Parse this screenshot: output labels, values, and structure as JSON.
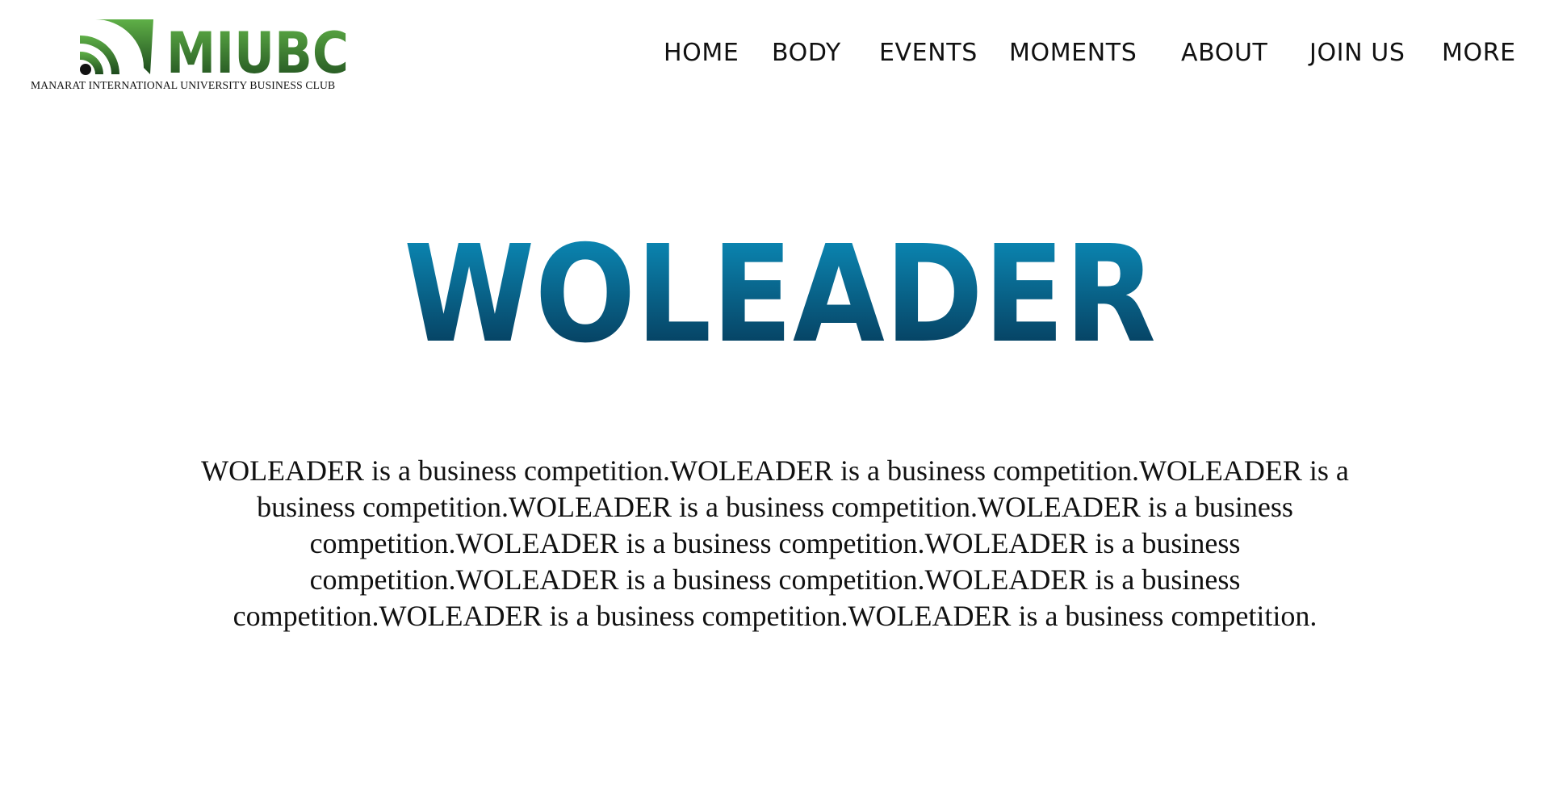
{
  "header": {
    "logo": {
      "mark_text": "MIUBC",
      "tagline": "MANARAT INTERNATIONAL UNIVERSITY BUSINESS CLUB",
      "mark_color_top": "#55a73f",
      "mark_color_bottom": "#1f4f20",
      "icon": "wifi-signal-icon"
    },
    "nav": [
      {
        "label": "HOME"
      },
      {
        "label": "BODY"
      },
      {
        "label": "EVENTS"
      },
      {
        "label": "MOMENTS"
      },
      {
        "label": "ABOUT"
      },
      {
        "label": "JOIN US"
      },
      {
        "label": "MORE"
      }
    ]
  },
  "hero": {
    "title": "WOLEADER",
    "gradient_top": "#0c94c2",
    "gradient_bottom": "#05304e"
  },
  "description": "WOLEADER is a business competition.WOLEADER is a business competition.WOLEADER is a business competition.WOLEADER is a business competition.WOLEADER is a business competition.WOLEADER is a business competition.WOLEADER is a business competition.WOLEADER is a business competition.WOLEADER is a business competition.WOLEADER is a business competition.WOLEADER is a business competition."
}
